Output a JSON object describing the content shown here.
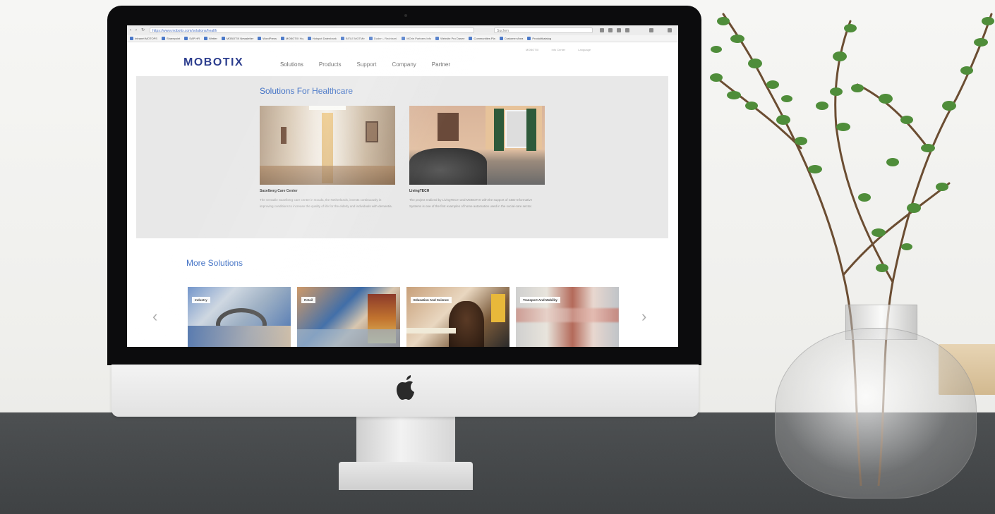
{
  "browser": {
    "url": "https://www.mobotix.com/solutions/health",
    "search_placeholder": "Suchen",
    "bookmarks": [
      "Intranet MOTOPS",
      "Sharepoint",
      "SAP HR",
      "Wetter",
      "MOBOTIX Newsletter",
      "WordPress",
      "MOBOTIX Hq",
      "Hotspot Datenbank",
      "BITLE MOTMtr",
      "Duden - Rechtsrei.",
      "MOrie Partners Info",
      "Website Pro Dasee",
      "Communities Pla",
      "Customer Area",
      "Produktkatalog"
    ]
  },
  "site": {
    "logo": "MOBOTIX",
    "nav": [
      "Solutions",
      "Products",
      "Support",
      "Company",
      "Partner"
    ],
    "util_nav": [
      "MOBOTIX",
      "Info Center",
      "Language"
    ]
  },
  "healthcare": {
    "title": "Solutions For Healthcare",
    "cards": [
      {
        "name": "Saxelberg Care Center",
        "desc": "The versatile Saxelberg care center in Gouda, the Netherlands, invests continuously in improving conditions to increase the quality of life for the elderly and individuals with dementia."
      },
      {
        "name": "LivingTECH",
        "desc": "The project realized by LivingTECH and MOBOTIX with the support of CBD-Informative Systems is one of the first examples of home automation used in the social-care sector."
      }
    ]
  },
  "more": {
    "title": "More Solutions",
    "tiles": [
      "Industry",
      "Retail",
      "Education And Science",
      "Transport And Mobility"
    ]
  },
  "colors": {
    "brand": "#2d3e8e",
    "accent": "#3a6cc3"
  },
  "icons": {
    "prev": "chevron-left-icon",
    "next": "chevron-right-icon"
  }
}
